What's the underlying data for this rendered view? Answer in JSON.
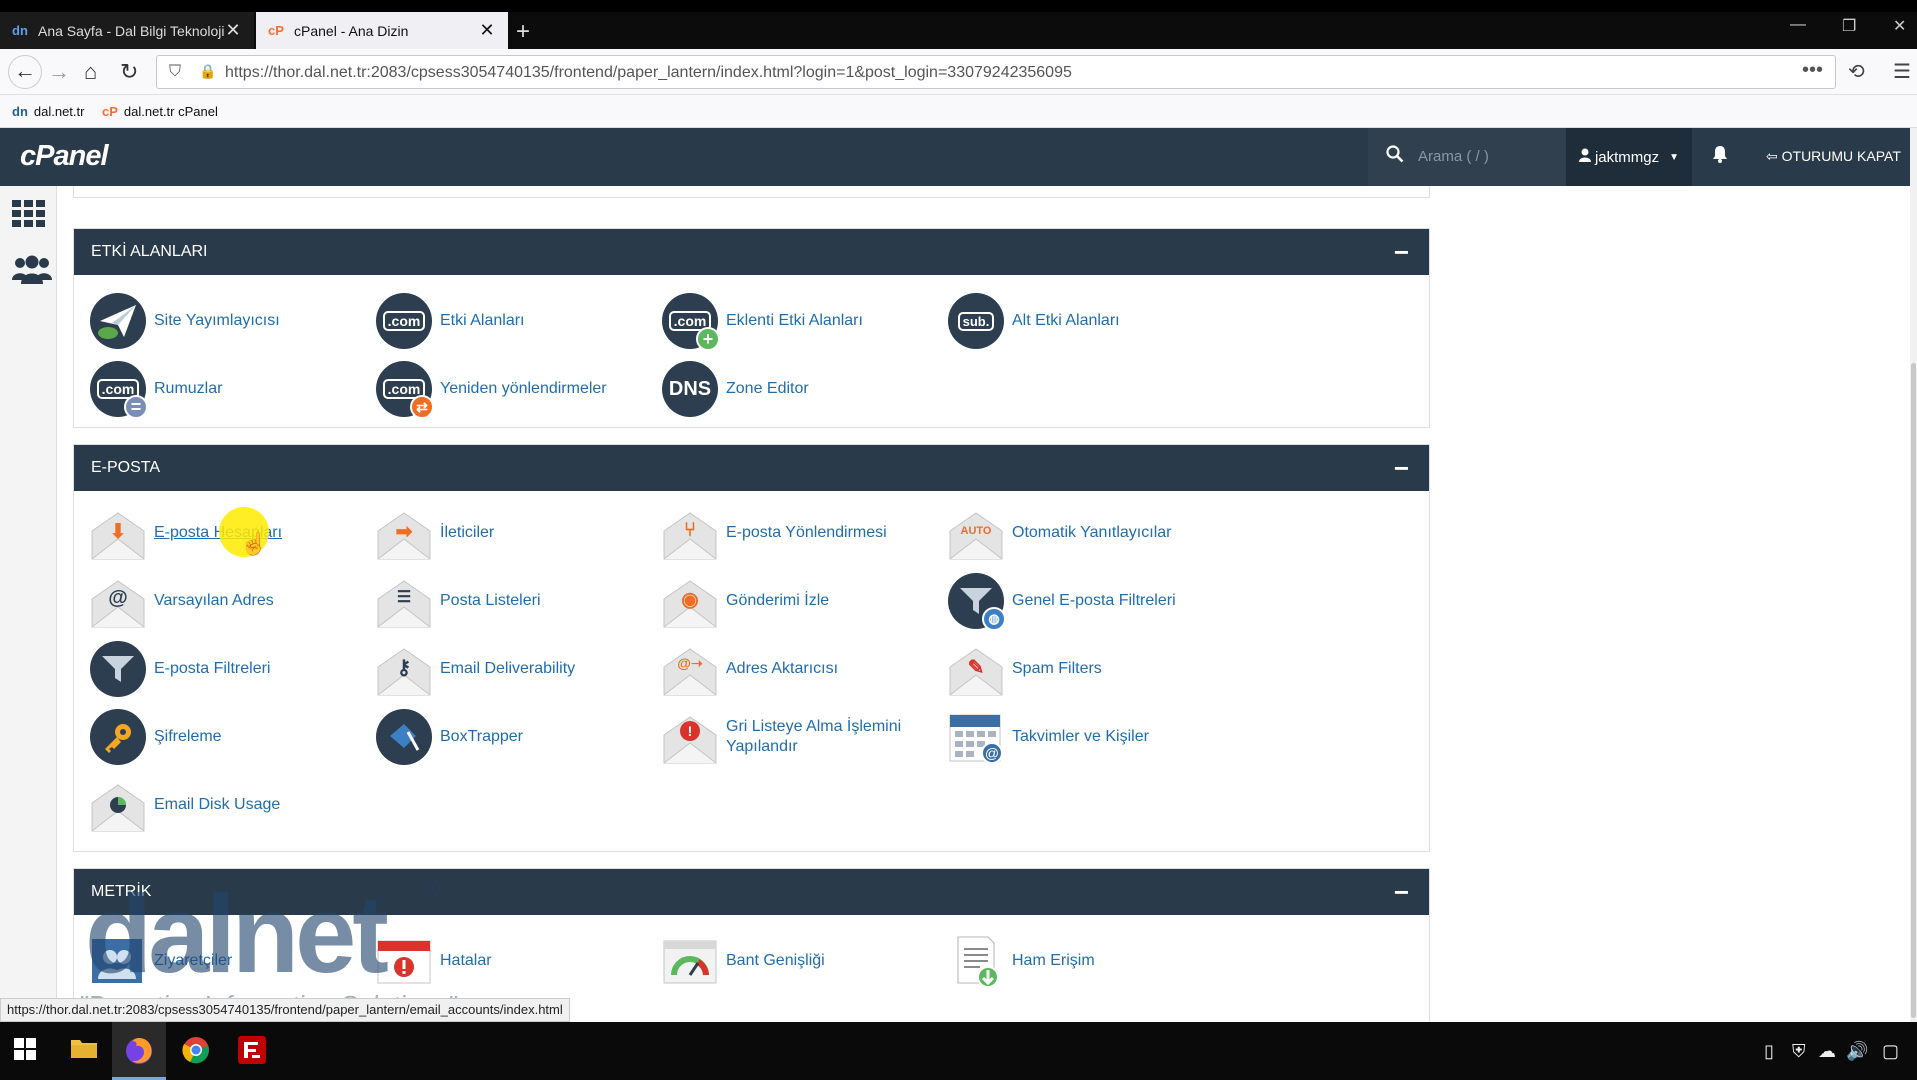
{
  "browser": {
    "tabs": [
      {
        "favicon": "dn",
        "title": "Ana Sayfa - Dal Bilgi Teknolojile",
        "close": "✕"
      },
      {
        "favicon": "cP",
        "title": "cPanel - Ana Dizin",
        "close": "✕"
      }
    ],
    "new_tab": "+",
    "url": "https://thor.dal.net.tr:2083/cpsess3054740135/frontend/paper_lantern/index.html?login=1&post_login=33079242356095",
    "bookmarks": [
      {
        "icon": "dn",
        "label": "dal.net.tr"
      },
      {
        "icon": "cP",
        "label": "dal.net.tr cPanel"
      }
    ],
    "status_url": "https://thor.dal.net.tr:2083/cpsess3054740135/frontend/paper_lantern/email_accounts/index.html"
  },
  "cpanel": {
    "logo": "cPanel",
    "search_placeholder": "Arama ( / )",
    "username": "jaktmmgz",
    "logout": "OTURUMU KAPAT",
    "sections": {
      "domains": {
        "title": "ETKİ ALANLARI",
        "collapse": "−",
        "items": [
          "Site Yayımlayıcısı",
          "Etki Alanları",
          "Eklenti Etki Alanları",
          "Alt Etki Alanları",
          "Rumuzlar",
          "Yeniden yönlendirmeler",
          "Zone Editor"
        ]
      },
      "email": {
        "title": "E-POSTA",
        "collapse": "−",
        "items": [
          "E-posta Hesapları",
          "İleticiler",
          "E-posta Yönlendirmesi",
          "Otomatik Yanıtlayıcılar",
          "Varsayılan Adres",
          "Posta Listeleri",
          "Gönderimi İzle",
          "Genel E-posta Filtreleri",
          "E-posta Filtreleri",
          "Email Deliverability",
          "Adres Aktarıcısı",
          "Spam Filters",
          "Şifreleme",
          "BoxTrapper",
          "Gri Listeye Alma İşlemini Yapılandır",
          "Takvimler ve Kişiler",
          "Email Disk Usage"
        ]
      },
      "metrics": {
        "title": "METRİK",
        "collapse": "−",
        "items": [
          "Ziyaretçiler",
          "Hatalar",
          "Bant Genişliği",
          "Ham Erişim"
        ]
      }
    }
  },
  "icon_text": {
    "com": ".com",
    "sub": "sub.",
    "dns": "DNS",
    "auto": "AUTO",
    "at": "@"
  },
  "watermark": {
    "brand": "dalnet",
    "reg": "®",
    "tagline": "\"Proactive Information Solutions\""
  },
  "colors": {
    "header": "#293a4a",
    "link": "#1f6db0",
    "accent_orange": "#f26c21",
    "badge_green": "#5cb85c"
  }
}
